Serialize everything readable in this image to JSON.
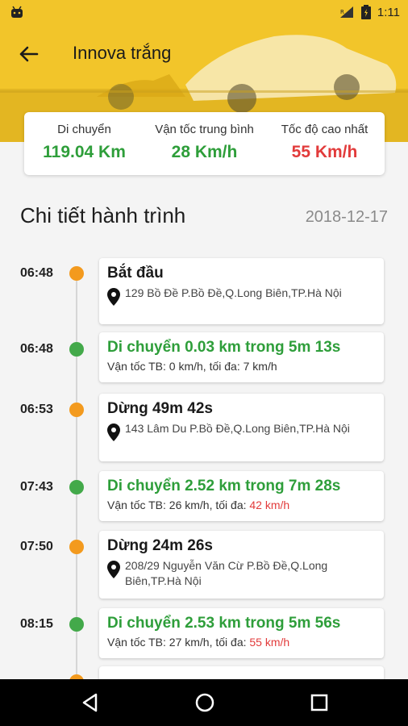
{
  "status_bar": {
    "time": "1:11"
  },
  "header": {
    "title": "Innova trắng"
  },
  "stats": [
    {
      "label": "Di chuyển",
      "value": "119.04 Km",
      "color": "#2e9e3a"
    },
    {
      "label": "Vận tốc trung bình",
      "value": "28 Km/h",
      "color": "#2e9e3a"
    },
    {
      "label": "Tốc độ cao nhất",
      "value": "55 Km/h",
      "color": "#e23b3b"
    }
  ],
  "section": {
    "title": "Chi tiết hành trình",
    "date": "2018-12-17"
  },
  "timeline": [
    {
      "time": "06:48",
      "head": "Bắt đầu",
      "addr": "129 Bồ Đề P.Bồ Đề,Q.Long Biên,TP.Hà Nội"
    },
    {
      "time": "06:48",
      "head": "Di chuyển 0.03 km trong 5m 13s",
      "speed": "Vận tốc TB: 0 km/h, tối đa: ",
      "max": "7 km/h"
    },
    {
      "time": "06:53",
      "head": "Dừng 49m 42s",
      "addr": "143 Lâm Du P.Bồ Đề,Q.Long Biên,TP.Hà Nội"
    },
    {
      "time": "07:43",
      "head": "Di chuyển 2.52 km trong 7m 28s",
      "speed": "Vận tốc TB: 26 km/h, tối đa: ",
      "max": "42 km/h"
    },
    {
      "time": "07:50",
      "head": "Dừng 24m 26s",
      "addr": "208/29 Nguyễn Văn Cừ P.Bồ Đề,Q.Long Biên,TP.Hà Nội"
    },
    {
      "time": "08:15",
      "head": "Di chuyển 2.53 km trong 5m 56s",
      "speed": "Vận tốc TB: 27 km/h, tối đa: ",
      "max": "55 km/h"
    }
  ]
}
